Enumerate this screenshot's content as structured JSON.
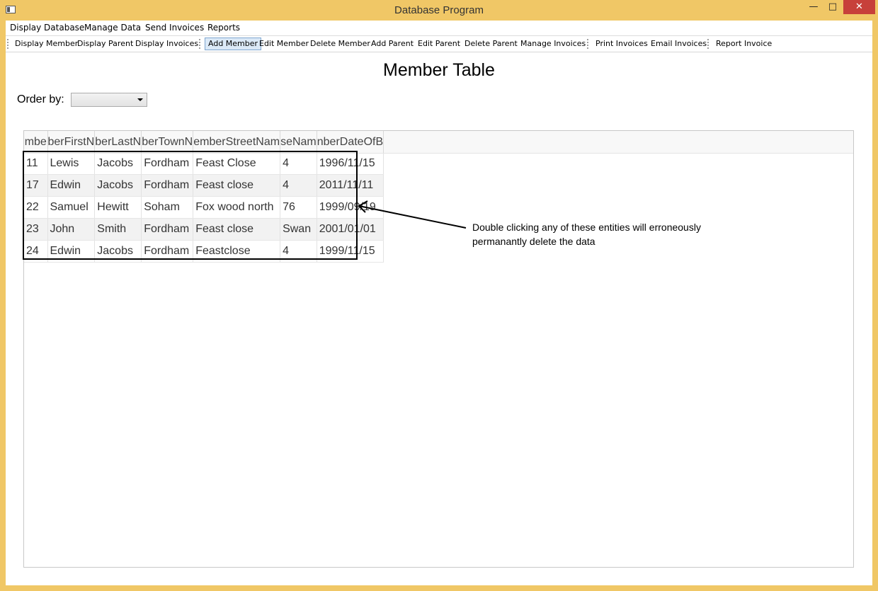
{
  "window": {
    "title": "Database Program",
    "controls": {
      "minimize": "—",
      "maximize": "□",
      "close": "✕"
    }
  },
  "menubar": [
    "Display Database",
    "Manage Data",
    "Send Invoices",
    "Reports"
  ],
  "toolbar": {
    "items": [
      "Display Member",
      "Display Parent",
      "Display Invoices",
      "Add Member",
      "Edit Member",
      "Delete Member",
      "Add Parent",
      "Edit Parent",
      "Delete Parent",
      "Manage Invoices",
      "Print Invoices",
      "Email Invoices",
      "Report Invoice"
    ],
    "active": "Add Member"
  },
  "page": {
    "title": "Member Table",
    "order_label": "Order by:",
    "order_value": ""
  },
  "table": {
    "columns": [
      "mbe",
      "berFirstN",
      "berLastN",
      "berTownN",
      "emberStreetNam",
      "seNam",
      "nberDateOfB"
    ],
    "rows": [
      [
        "11",
        "Lewis",
        "Jacobs",
        "Fordham",
        "Feast Close",
        "4",
        "1996/11/15"
      ],
      [
        "17",
        "Edwin",
        "Jacobs",
        "Fordham",
        "Feast close",
        "4",
        "2011/11/11"
      ],
      [
        "22",
        "Samuel",
        "Hewitt",
        "Soham",
        "Fox wood north",
        "76",
        "1999/09/19"
      ],
      [
        "23",
        "John",
        "Smith",
        "Fordham",
        "Feast close",
        "Swan",
        "2001/01/01"
      ],
      [
        "24",
        "Edwin",
        "Jacobs",
        "Fordham",
        "Feastclose",
        "4",
        "1999/11/15"
      ]
    ]
  },
  "annotation": {
    "line1": "Double clicking any of these entities will erroneously",
    "line2": "permanantly delete the data"
  }
}
